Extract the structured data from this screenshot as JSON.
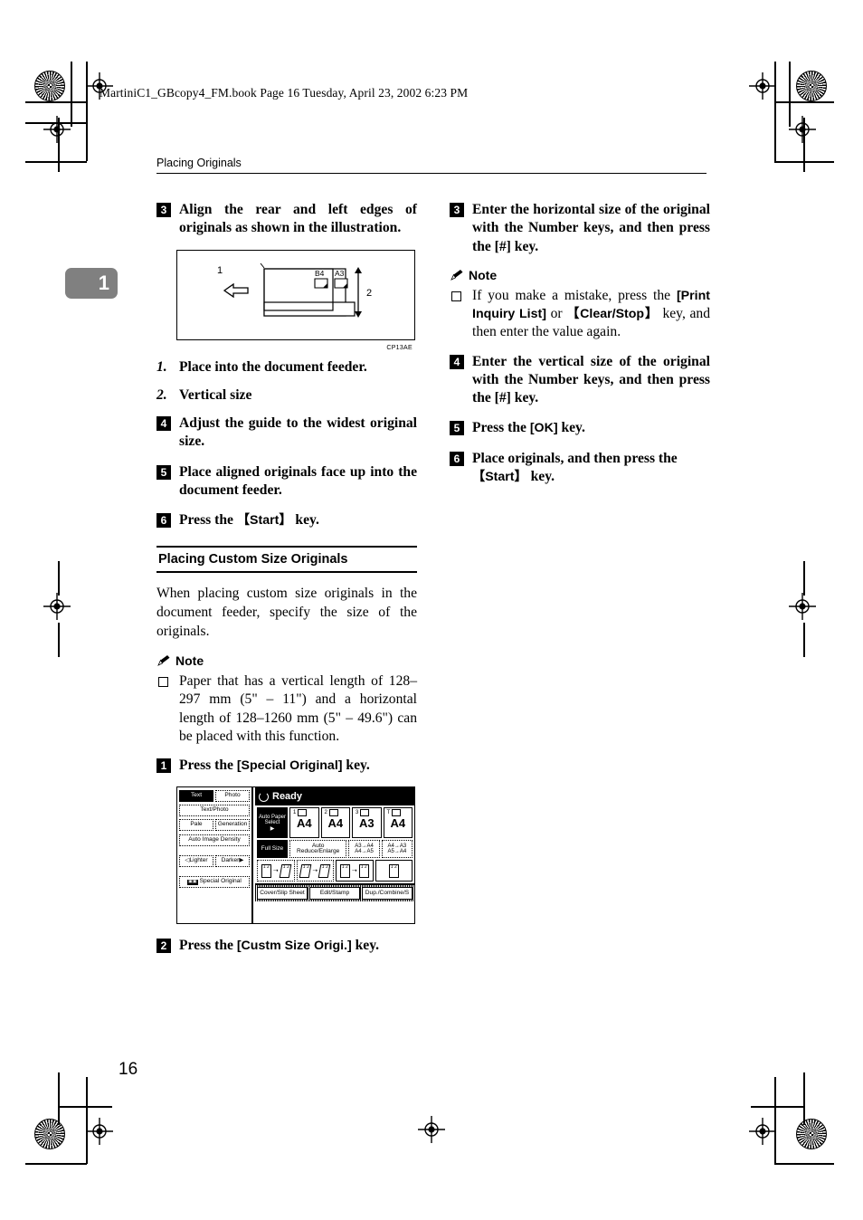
{
  "filebar": "MartiniC1_GBcopy4_FM.book  Page 16  Tuesday, April 23, 2002  6:23 PM",
  "chapter_tab": "1",
  "running_head": "Placing Originals",
  "page_number": "16",
  "left_column": {
    "step3": {
      "num": "3",
      "text": "Align the rear and left edges of originals as shown in the illustration."
    },
    "figure": {
      "label_1": "1",
      "label_2": "2",
      "label_b4": "B4",
      "label_a3": "A3",
      "caption": "CP13AE"
    },
    "sublist": [
      {
        "marker": "1.",
        "text": "Place into the document feeder."
      },
      {
        "marker": "2.",
        "text": "Vertical size"
      }
    ],
    "step4": {
      "num": "4",
      "text": "Adjust the guide to the widest original size."
    },
    "step5": {
      "num": "5",
      "text": "Place aligned originals face up into the document feeder."
    },
    "step6": {
      "num": "6",
      "prefix": "Press the ",
      "key": "【Start】",
      "suffix": " key."
    },
    "section_heading": "Placing Custom Size Originals",
    "intro_paragraph": "When placing custom size originals in the document feeder, specify the size of the originals.",
    "note_label": "Note",
    "note_item": "Paper that has a vertical length of 128–297 mm (5\" – 11\") and a horizontal length of 128–1260 mm (5\" – 49.6\") can be placed with this function.",
    "step1": {
      "num": "1",
      "prefix": "Press the ",
      "key": "[Special Original]",
      "suffix": " key."
    },
    "step2": {
      "num": "2",
      "prefix": "Press the ",
      "key": "[Custm Size Origi.]",
      "suffix": " key."
    }
  },
  "lcd_panel": {
    "status": "Ready",
    "sidebar": {
      "text": "Text",
      "photo": "Photo",
      "text_photo": "Text/Photo",
      "pale": "Pale",
      "generation": "Generation",
      "auto_image_density": "Auto Image Density",
      "lighter": "Lighter",
      "darker": "Darker",
      "special_original": "Special Original"
    },
    "paper_select_label": "Auto Paper Select",
    "trays": [
      {
        "index": "1",
        "size": "A4"
      },
      {
        "index": "2",
        "size": "A4"
      },
      {
        "index": "3",
        "size": "A3"
      },
      {
        "index": "T",
        "size": "A4"
      }
    ],
    "zoom_row": {
      "full_size": "Full Size",
      "auto_reduce_enlarge": "Auto Reduce/Enlarge",
      "reduce": "A3→A4\nA4→A5",
      "enlarge": "A4→A3\nA5→A4"
    },
    "bottom_row": {
      "cover_slip_sheet": "Cover/Slip Sheet",
      "edit_stamp": "Edit/Stamp",
      "dup_combine": "Dup./Combine/S"
    }
  },
  "right_column": {
    "step3": {
      "num": "3",
      "text": "Enter the horizontal size of the original with the Number keys, and then press the [#] key."
    },
    "note_label": "Note",
    "note_item": {
      "part1": "If you make a mistake, press the ",
      "key1": "[Print Inquiry List]",
      "mid": " or ",
      "key2": "【Clear/Stop】",
      "part2": " key, and then enter the value again."
    },
    "step4": {
      "num": "4",
      "text": "Enter the vertical size of the original with the Number keys, and then press the [#] key."
    },
    "step5": {
      "num": "5",
      "prefix": "Press the ",
      "key": "[OK]",
      "suffix": " key."
    },
    "step6": {
      "num": "6",
      "prefix": "Place originals, and then press the ",
      "key": "【Start】",
      "suffix": " key."
    }
  }
}
